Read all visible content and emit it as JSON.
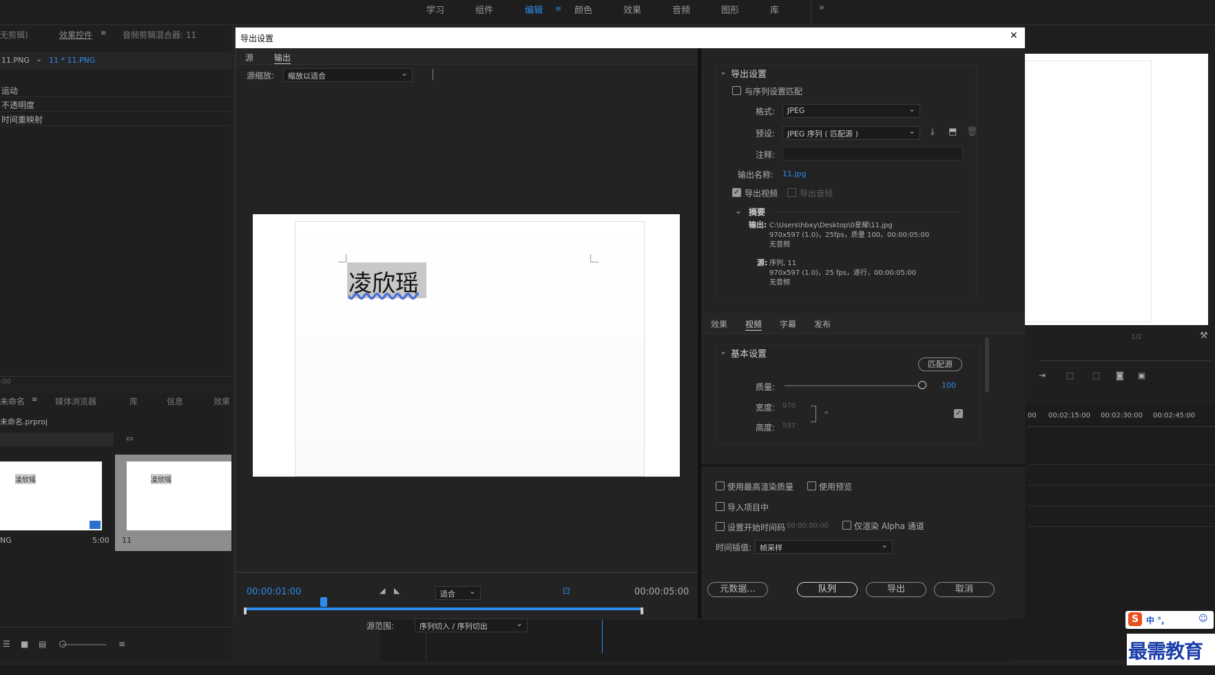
{
  "workspace_tabs": [
    "学习",
    "组件",
    "编辑",
    "颜色",
    "效果",
    "音频",
    "图形",
    "库"
  ],
  "workspace_active_index": 2,
  "workspace_more": "»",
  "left_panel": {
    "tabs": [
      "无剪辑)",
      "效果控件",
      "音频剪辑混合器: 11"
    ],
    "clip_tabs": [
      "11.PNG",
      "11 * 11.PNG"
    ],
    "effects": [
      "运动",
      "不透明度",
      "时间重映射"
    ],
    "timecode": ":00"
  },
  "project_panel": {
    "tabs": [
      "未命名",
      "媒体浏览器",
      "库",
      "信息",
      "效果"
    ],
    "project_name": "未命名.prproj",
    "items": [
      {
        "thumb_text": "凌欣瑶",
        "name": "NG",
        "duration": "5:00"
      },
      {
        "thumb_text": "凌欣瑶",
        "name": "11",
        "duration": ""
      }
    ]
  },
  "dialog": {
    "title": "导出设置",
    "close": "✕",
    "tabs": [
      "源",
      "输出"
    ],
    "active_tab": 1,
    "source_scale_label": "源缩放:",
    "source_scale_value": "缩放以适合",
    "preview_text": "凌欣瑶",
    "playback": {
      "current_time": "00:00:01:00",
      "fit_value": "适合",
      "end_time": "00:00:05:00",
      "range_label": "源范围:",
      "range_value": "序列切入 / 序列切出",
      "playhead_fraction": 0.2
    },
    "export_settings": {
      "header": "导出设置",
      "match_sequence": "与序列设置匹配",
      "format_label": "格式:",
      "format_value": "JPEG",
      "preset_label": "预设:",
      "preset_value": "JPEG 序列 ( 匹配源 )",
      "comment_label": "注释:",
      "comment_value": "",
      "output_name_label": "输出名称:",
      "output_name_value": "11.jpg",
      "export_video": "导出视频",
      "export_audio": "导出音频",
      "summary_header": "摘要",
      "output_label": "输出:",
      "output_lines": [
        "C:\\Users\\hbxy\\Desktop\\0星耀\\11.jpg",
        "970x597 (1.0)，25fps，质量 100，00:00:05:00",
        "无音频"
      ],
      "source_label": "源:",
      "source_lines": [
        "序列, 11",
        "970x597 (1.0)，25 fps，逐行，00:00:05:00",
        "无音频"
      ]
    },
    "settings_tabs": [
      "效果",
      "视频",
      "字幕",
      "发布"
    ],
    "settings_active_tab": 1,
    "basic": {
      "header": "基本设置",
      "match_source_button": "匹配源",
      "quality_label": "质量:",
      "quality_value": "100",
      "quality_fraction": 1.0,
      "width_label": "宽度:",
      "width_value": "970",
      "height_label": "高度:",
      "height_value": "597"
    },
    "bottom": {
      "max_render_quality": "使用最高渲染质量",
      "use_previews": "使用预览",
      "import_into_project": "导入项目中",
      "set_start_timecode": "设置开始时间码",
      "start_timecode_value": "00:00:00:00",
      "render_alpha_only": "仅渲染 Alpha 通道",
      "time_interpolation_label": "时间插值:",
      "time_interpolation_value": "帧采样",
      "metadata_button": "元数据...",
      "queue_button": "队列",
      "export_button": "导出",
      "cancel_button": "取消"
    }
  },
  "right_panel": {
    "page_label": "1/2",
    "ruler_times": [
      "00",
      "00:02:15:00",
      "00:02:30:00",
      "00:02:45:00"
    ]
  },
  "watermark": {
    "ime_text": "中 °,",
    "brand": "最需教育"
  }
}
